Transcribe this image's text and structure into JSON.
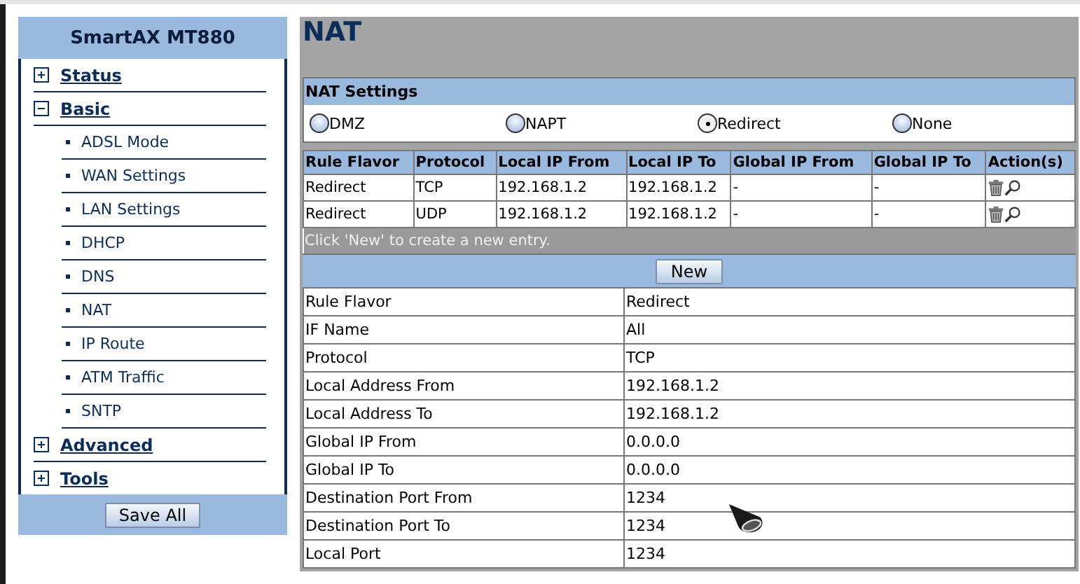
{
  "sidebar": {
    "title": "SmartAX MT880",
    "items": [
      {
        "label": "Status",
        "expanded": false
      },
      {
        "label": "Basic",
        "expanded": true,
        "children": [
          {
            "label": "ADSL Mode"
          },
          {
            "label": "WAN Settings"
          },
          {
            "label": "LAN Settings"
          },
          {
            "label": "DHCP"
          },
          {
            "label": "DNS"
          },
          {
            "label": "NAT"
          },
          {
            "label": "IP Route"
          },
          {
            "label": "ATM Traffic"
          },
          {
            "label": "SNTP"
          }
        ]
      },
      {
        "label": "Advanced",
        "expanded": false
      },
      {
        "label": "Tools",
        "expanded": false
      }
    ],
    "save_button": "Save All"
  },
  "page_title": "NAT",
  "nat_settings": {
    "title": "NAT Settings",
    "options": [
      {
        "label": "DMZ",
        "selected": false
      },
      {
        "label": "NAPT",
        "selected": false
      },
      {
        "label": "Redirect",
        "selected": true
      },
      {
        "label": "None",
        "selected": false
      }
    ]
  },
  "rules": {
    "columns": [
      "Rule Flavor",
      "Protocol",
      "Local IP From",
      "Local IP To",
      "Global IP From",
      "Global IP To",
      "Action(s)"
    ],
    "rows": [
      [
        "Redirect",
        "TCP",
        "192.168.1.2",
        "192.168.1.2",
        "-",
        "-"
      ],
      [
        "Redirect",
        "UDP",
        "192.168.1.2",
        "192.168.1.2",
        "-",
        "-"
      ]
    ]
  },
  "hint": "Click 'New' to create a new entry.",
  "new_button": "New",
  "details": [
    {
      "label": "Rule Flavor",
      "value": "Redirect"
    },
    {
      "label": "IF Name",
      "value": "All"
    },
    {
      "label": "Protocol",
      "value": "TCP"
    },
    {
      "label": "Local Address From",
      "value": "192.168.1.2"
    },
    {
      "label": "Local Address To",
      "value": "192.168.1.2"
    },
    {
      "label": "Global IP From",
      "value": "0.0.0.0"
    },
    {
      "label": "Global IP To",
      "value": "0.0.0.0"
    },
    {
      "label": "Destination Port From",
      "value": "1234"
    },
    {
      "label": "Destination Port To",
      "value": "1234"
    },
    {
      "label": "Local Port",
      "value": "1234"
    }
  ]
}
